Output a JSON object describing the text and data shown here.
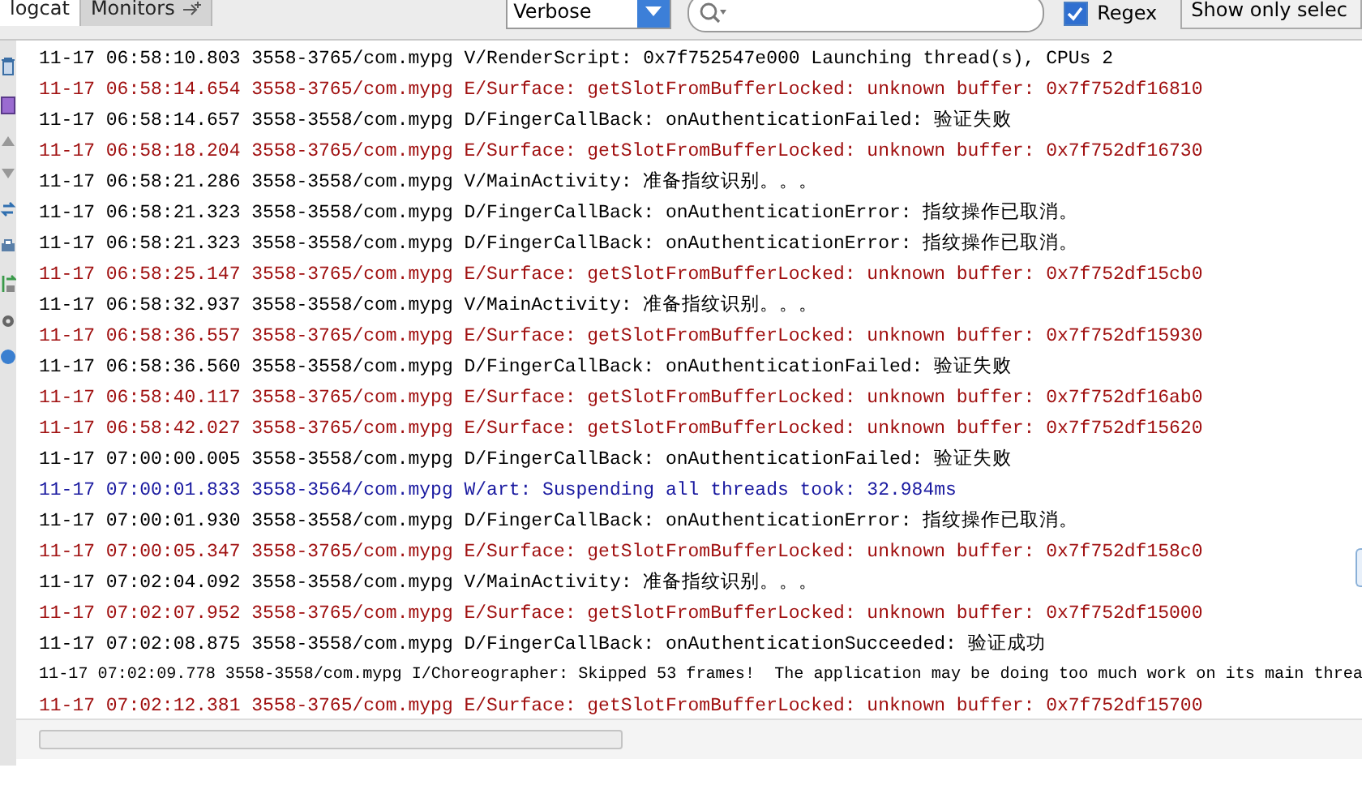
{
  "tabs": [
    {
      "label": "logcat",
      "selected": true
    },
    {
      "label": "Monitors",
      "selected": false
    }
  ],
  "filter": {
    "level": "Verbose"
  },
  "regex": {
    "label": "Regex",
    "checked": true
  },
  "show_only_button": "Show only selec",
  "log_rows": [
    {
      "kind": "verbose",
      "text": "11-17 06:58:10.803 3558-3765/com.mypg V/RenderScript: 0x7f752547e000 Launching thread(s), CPUs 2"
    },
    {
      "kind": "error",
      "text": "11-17 06:58:14.654 3558-3765/com.mypg E/Surface: getSlotFromBufferLocked: unknown buffer: 0x7f752df16810"
    },
    {
      "kind": "debug",
      "text": "11-17 06:58:14.657 3558-3558/com.mypg D/FingerCallBack: onAuthenticationFailed: 验证失败"
    },
    {
      "kind": "error",
      "text": "11-17 06:58:18.204 3558-3765/com.mypg E/Surface: getSlotFromBufferLocked: unknown buffer: 0x7f752df16730"
    },
    {
      "kind": "verbose",
      "text": "11-17 06:58:21.286 3558-3558/com.mypg V/MainActivity: 准备指纹识别。。。"
    },
    {
      "kind": "debug",
      "text": "11-17 06:58:21.323 3558-3558/com.mypg D/FingerCallBack: onAuthenticationError: 指纹操作已取消。"
    },
    {
      "kind": "debug",
      "text": "11-17 06:58:21.323 3558-3558/com.mypg D/FingerCallBack: onAuthenticationError: 指纹操作已取消。"
    },
    {
      "kind": "error",
      "text": "11-17 06:58:25.147 3558-3765/com.mypg E/Surface: getSlotFromBufferLocked: unknown buffer: 0x7f752df15cb0"
    },
    {
      "kind": "verbose",
      "text": "11-17 06:58:32.937 3558-3558/com.mypg V/MainActivity: 准备指纹识别。。。"
    },
    {
      "kind": "error",
      "text": "11-17 06:58:36.557 3558-3765/com.mypg E/Surface: getSlotFromBufferLocked: unknown buffer: 0x7f752df15930"
    },
    {
      "kind": "debug",
      "text": "11-17 06:58:36.560 3558-3558/com.mypg D/FingerCallBack: onAuthenticationFailed: 验证失败"
    },
    {
      "kind": "error",
      "text": "11-17 06:58:40.117 3558-3765/com.mypg E/Surface: getSlotFromBufferLocked: unknown buffer: 0x7f752df16ab0"
    },
    {
      "kind": "error",
      "text": "11-17 06:58:42.027 3558-3765/com.mypg E/Surface: getSlotFromBufferLocked: unknown buffer: 0x7f752df15620"
    },
    {
      "kind": "debug",
      "text": "11-17 07:00:00.005 3558-3558/com.mypg D/FingerCallBack: onAuthenticationFailed: 验证失败"
    },
    {
      "kind": "warn",
      "text": "11-17 07:00:01.833 3558-3564/com.mypg W/art: Suspending all threads took: 32.984ms"
    },
    {
      "kind": "debug",
      "text": "11-17 07:00:01.930 3558-3558/com.mypg D/FingerCallBack: onAuthenticationError: 指纹操作已取消。"
    },
    {
      "kind": "error",
      "text": "11-17 07:00:05.347 3558-3765/com.mypg E/Surface: getSlotFromBufferLocked: unknown buffer: 0x7f752df158c0"
    },
    {
      "kind": "verbose",
      "text": "11-17 07:02:04.092 3558-3558/com.mypg V/MainActivity: 准备指纹识别。。。"
    },
    {
      "kind": "error",
      "text": "11-17 07:02:07.952 3558-3765/com.mypg E/Surface: getSlotFromBufferLocked: unknown buffer: 0x7f752df15000"
    },
    {
      "kind": "debug",
      "text": "11-17 07:02:08.875 3558-3558/com.mypg D/FingerCallBack: onAuthenticationSucceeded: 验证成功"
    },
    {
      "kind": "info",
      "text": "11-17 07:02:09.778 3558-3558/com.mypg I/Choreographer: Skipped 53 frames!  The application may be doing too much work on its main threa"
    },
    {
      "kind": "error",
      "text": "11-17 07:02:12.381 3558-3765/com.mypg E/Surface: getSlotFromBufferLocked: unknown buffer: 0x7f752df15700"
    }
  ]
}
